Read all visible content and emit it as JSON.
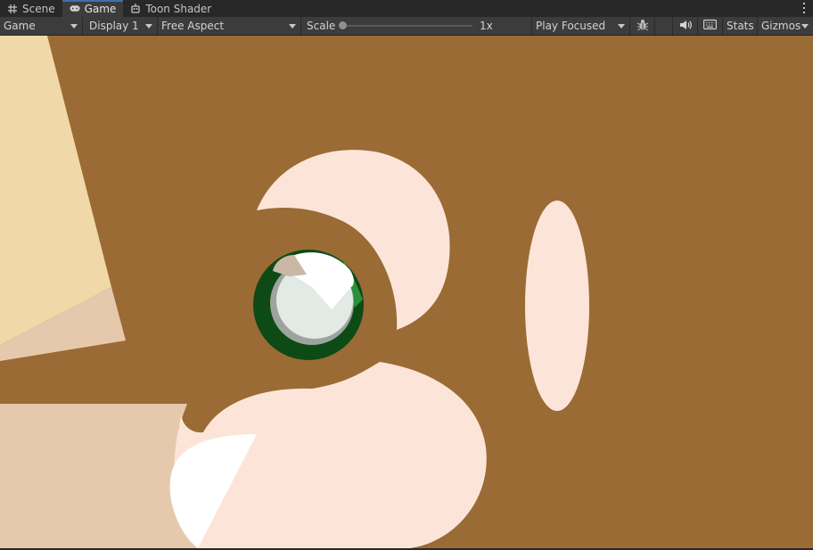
{
  "tabs": [
    {
      "label": "Scene",
      "icon": "grid-icon",
      "active": false
    },
    {
      "label": "Game",
      "icon": "gamepad-icon",
      "active": true
    },
    {
      "label": "Toon Shader",
      "icon": "robot-icon",
      "active": false
    }
  ],
  "toolbar": {
    "mode_label": "Game",
    "display_label": "Display 1",
    "aspect_label": "Free Aspect",
    "scale_label": "Scale",
    "scale_value": "1x",
    "scale_level": 0,
    "play_mode_label": "Play Focused",
    "stats_label": "Stats",
    "gizmos_label": "Gizmos",
    "icons": [
      "bug-icon",
      "speaker-icon",
      "keyboard-icon",
      "kebab-menu-icon"
    ]
  },
  "colors": {
    "background": "#9b6b35",
    "skin_light": "#fce5d8",
    "skin_mid": "#e6c9ad",
    "beige": "#f1d8a9",
    "eye_dark": "#0d4a16",
    "eye_white": "#e3e9e4",
    "highlight": "#ffffff"
  }
}
